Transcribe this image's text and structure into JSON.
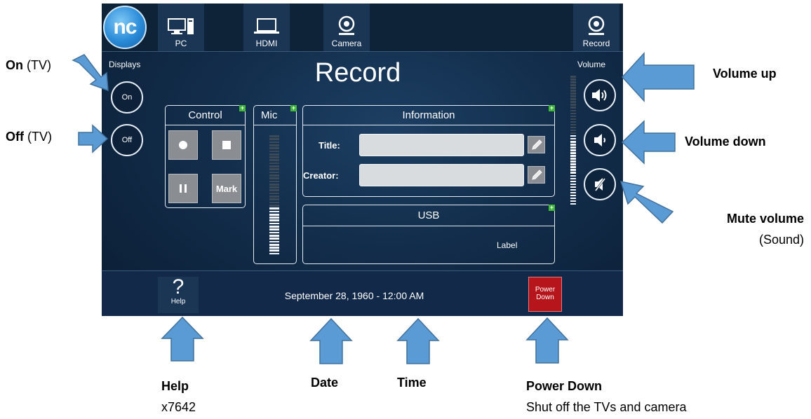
{
  "panel": {
    "logo_text": "nc",
    "sources": [
      {
        "label": "PC",
        "icon": "pc-icon"
      },
      {
        "label": "HDMI",
        "icon": "laptop-icon"
      },
      {
        "label": "Camera",
        "icon": "camera-icon"
      }
    ],
    "record_tab": {
      "label": "Record",
      "icon": "camera-icon"
    },
    "page_title": "Record",
    "displays": {
      "label": "Displays",
      "on_label": "On",
      "off_label": "Off"
    },
    "volume": {
      "label": "Volume",
      "level": 0.55
    },
    "control": {
      "title": "Control",
      "mark_label": "Mark"
    },
    "mic": {
      "title": "Mic",
      "level": 0.4
    },
    "information": {
      "title": "Information",
      "title_label": "Title:",
      "title_value": "",
      "creator_label": "Creator:",
      "creator_value": ""
    },
    "usb": {
      "title": "USB",
      "label": "Label"
    },
    "help": {
      "symbol": "?",
      "label": "Help"
    },
    "datetime": "September 28, 1960 - 12:00 AM",
    "power_down": {
      "line1": "Power",
      "line2": "Down"
    }
  },
  "annotations": {
    "on": {
      "bold": "On",
      "rest": " (TV)"
    },
    "off": {
      "bold": "Off",
      "rest": " (TV)"
    },
    "volume_up": "Volume up",
    "volume_down": "Volume down",
    "mute": {
      "bold": "Mute volume",
      "rest": "(Sound)"
    },
    "help": {
      "bold": "Help",
      "rest": "x7642"
    },
    "date": "Date",
    "time": "Time",
    "power_down": {
      "bold": "Power Down",
      "rest": "Shut off the TVs and camera"
    }
  },
  "colors": {
    "arrow": "#5b9bd5",
    "arrow_stroke": "#41719c",
    "power": "#b5151b",
    "plus": "#41b83a"
  }
}
